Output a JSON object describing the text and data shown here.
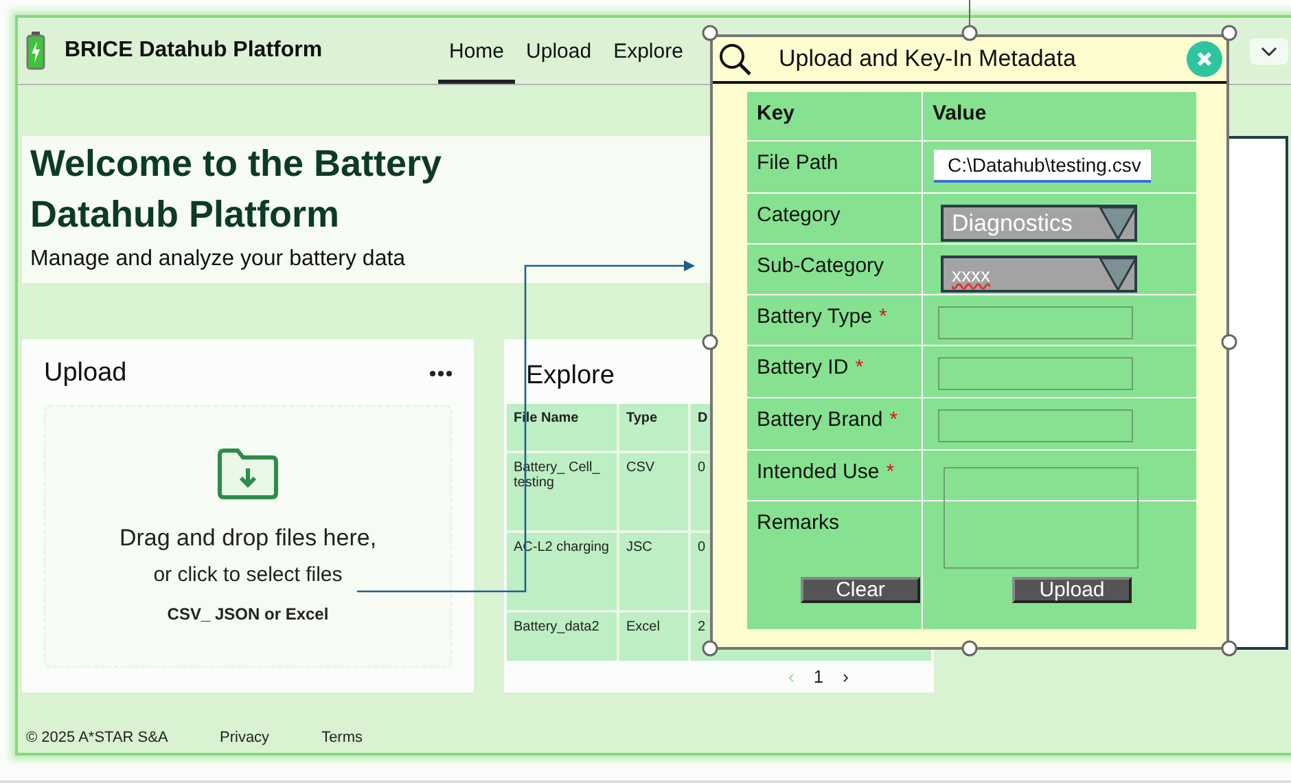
{
  "app": {
    "title": "BRICE Datahub Platform"
  },
  "nav": [
    {
      "label": "Home",
      "selected": true
    },
    {
      "label": "Upload",
      "selected": false
    },
    {
      "label": "Explore",
      "selected": false
    }
  ],
  "user_menu": {
    "kind": "dropdown"
  },
  "hero": {
    "title": "Welcome to the Battery Datahub Platform",
    "subtitle": "Manage and analyze your battery data"
  },
  "upload_card": {
    "title": "Upload",
    "line_1": "Drag and drop files here,",
    "line_2": "or click to select files",
    "formats": "CSV_ JSON or Excel"
  },
  "explore_card": {
    "title": "Explore",
    "columns": [
      "File Name",
      "Type",
      "D"
    ],
    "rows": [
      [
        "Battery_ Cell_ testing",
        "CSV",
        "0"
      ],
      [
        "AC-L2 charging",
        "JSC",
        "0"
      ],
      [
        "Battery_data2",
        "Excel",
        "2"
      ]
    ],
    "pagination": {
      "prev": {
        "label": "‹",
        "disabled": true
      },
      "page": "1",
      "next": {
        "label": "›",
        "disabled": false
      }
    }
  },
  "footer": {
    "copyright": "© 2025 A*STAR S&A",
    "links": [
      "Privacy",
      "Terms"
    ]
  },
  "dialog": {
    "title": "Upload and Key-In Metadata",
    "columns": [
      "Key",
      "Value"
    ],
    "fields": [
      {
        "label": "File Path",
        "kind": "text",
        "value": "C:\\Datahub\\testing.csv"
      },
      {
        "label": "Category",
        "kind": "select",
        "value": "Diagnostics"
      },
      {
        "label": "Sub-Category",
        "kind": "select",
        "value": "xxxx",
        "misspelled": true
      },
      {
        "label": "Battery Type",
        "kind": "input",
        "marker": "*"
      },
      {
        "label": "Battery ID",
        "kind": "input",
        "marker": "*"
      },
      {
        "label": "Battery Brand",
        "kind": "input",
        "marker": "*"
      },
      {
        "label": "Intended Use",
        "kind": "textarea",
        "marker": "*"
      },
      {
        "label": "Remarks",
        "kind": "note"
      }
    ],
    "buttons": [
      "Clear",
      "Upload"
    ]
  }
}
